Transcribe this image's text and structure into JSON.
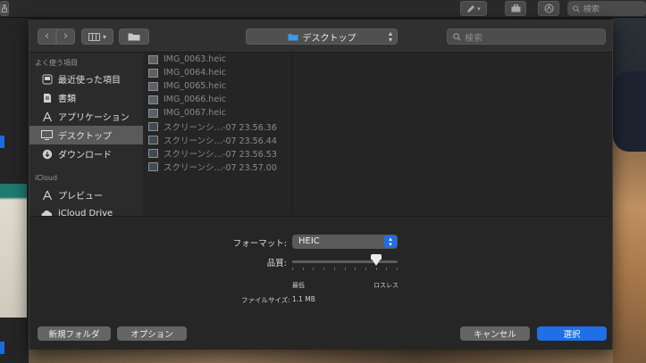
{
  "background_app": {
    "search_placeholder": "検索"
  },
  "dialog": {
    "toolbar": {
      "back_glyph": "‹",
      "forward_glyph": "›",
      "location": "デスクトップ",
      "search_placeholder": "検索"
    },
    "sidebar": {
      "favorites_title": "よく使う項目",
      "favorites": [
        {
          "label": "最近使った項目",
          "icon": "clock-icon"
        },
        {
          "label": "書類",
          "icon": "document-icon"
        },
        {
          "label": "アプリケーション",
          "icon": "applications-icon"
        },
        {
          "label": "デスクトップ",
          "icon": "desktop-icon",
          "selected": true
        },
        {
          "label": "ダウンロード",
          "icon": "download-icon"
        }
      ],
      "icloud_title": "iCloud",
      "icloud": [
        {
          "label": "プレビュー",
          "icon": "preview-icon"
        },
        {
          "label": "iCloud Drive",
          "icon": "cloud-icon"
        }
      ]
    },
    "files": [
      {
        "name": "IMG_0063.heic",
        "icon": "image-file-icon"
      },
      {
        "name": "IMG_0064.heic",
        "icon": "image-file-icon"
      },
      {
        "name": "IMG_0065.heic",
        "icon": "image-file-icon"
      },
      {
        "name": "IMG_0066.heic",
        "icon": "image-file-icon"
      },
      {
        "name": "IMG_0067.heic",
        "icon": "image-file-icon"
      },
      {
        "name": "スクリーンシ…-07 23.56.36",
        "icon": "screenshot-file-icon"
      },
      {
        "name": "スクリーンシ…-07 23.56.44",
        "icon": "screenshot-file-icon"
      },
      {
        "name": "スクリーンシ…-07 23.56.53",
        "icon": "screenshot-file-icon"
      },
      {
        "name": "スクリーンシ…-07 23.57.00",
        "icon": "screenshot-file-icon"
      }
    ],
    "options": {
      "format_label": "フォーマット:",
      "format_value": "HEIC",
      "quality_label": "品質:",
      "quality_level": 0.8,
      "quality_min_label": "最低",
      "quality_max_label": "ロスレス",
      "filesize_label": "ファイルサイズ:",
      "filesize_value": "1.1 MB"
    },
    "buttons": {
      "new_folder": "新規フォルダ",
      "options": "オプション",
      "cancel": "キャンセル",
      "select": "選択"
    }
  },
  "colors": {
    "accent": "#1f6fe6",
    "sheet_bg": "#262626",
    "selected_row": "#5a5a5a"
  }
}
